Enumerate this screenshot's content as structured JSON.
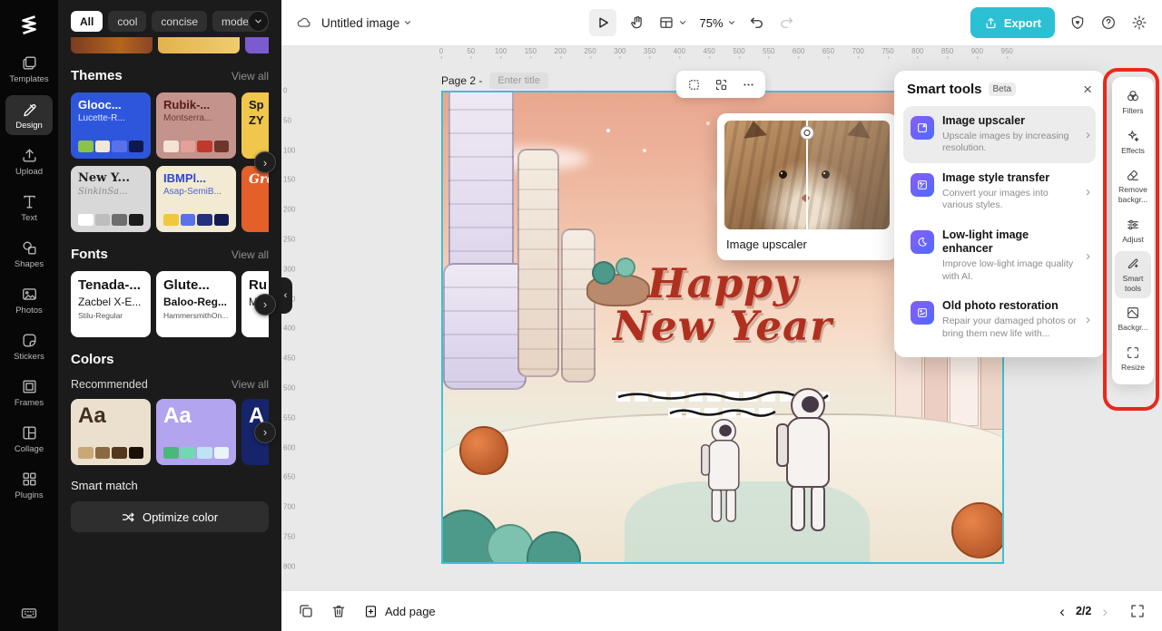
{
  "rail": {
    "items": [
      {
        "label": "Templates"
      },
      {
        "label": "Design"
      },
      {
        "label": "Upload"
      },
      {
        "label": "Text"
      },
      {
        "label": "Shapes"
      },
      {
        "label": "Photos"
      },
      {
        "label": "Stickers"
      },
      {
        "label": "Frames"
      },
      {
        "label": "Collage"
      },
      {
        "label": "Plugins"
      }
    ]
  },
  "panel": {
    "chips": [
      {
        "label": "All"
      },
      {
        "label": "cool"
      },
      {
        "label": "concise"
      },
      {
        "label": "modern"
      }
    ],
    "themes_title": "Themes",
    "view_all": "View all",
    "theme_cards": [
      {
        "title": "Glooc...",
        "subtitle": "Lucette-R...",
        "bg": "#2e56dd",
        "title_color": "#ffffff",
        "sub_color": "#dfe5ff",
        "palette": [
          "#8bc34a",
          "#f1e9d4",
          "#5872e8",
          "#10194d"
        ]
      },
      {
        "title": "Rubik-...",
        "subtitle": "Montserra...",
        "bg": "#c4938c",
        "title_color": "#551d16",
        "sub_color": "#6d3a33",
        "palette": [
          "#f3e3d3",
          "#e5a09a",
          "#c0392b",
          "#6e352a"
        ]
      },
      {
        "title": "Sp",
        "subtitle": "ZY",
        "bg": "#f0c64d",
        "title_color": "#181818",
        "sub_color": "#181818",
        "palette": []
      },
      {
        "title": "New Y...",
        "subtitle": "SinkinSa...",
        "bg": "#d8d8d8",
        "title_color": "#202020",
        "sub_color": "#8a8a8a",
        "palette": [
          "#ffffff",
          "#bdbdbd",
          "#6e6e6e",
          "#1c1c1c"
        ]
      },
      {
        "title": "IBMPl...",
        "subtitle": "Asap-SemiB...",
        "bg": "#f2ead2",
        "title_color": "#2c49c9",
        "sub_color": "#4b62d8",
        "palette": [
          "#efc83d",
          "#5872e8",
          "#24317e",
          "#131c52"
        ]
      },
      {
        "title": "Gro",
        "subtitle": "",
        "bg": "#e4602a",
        "title_color": "#ffffff",
        "sub_color": "#ffffff",
        "palette": []
      }
    ],
    "fonts_title": "Fonts",
    "font_cards": [
      {
        "line1": "Tenada-...",
        "line2": "Zacbel X-E...",
        "line3": "Stilu-Regular"
      },
      {
        "line1": "Glute...",
        "line2": "Baloo-Reg...",
        "line3": "HammersmithOn..."
      },
      {
        "line1": "Ru",
        "line2": "Mor",
        "line3": ""
      }
    ],
    "colors_title": "Colors",
    "recommended_label": "Recommended",
    "color_cards": [
      {
        "sample": "Aa",
        "bg": "#eae0cd",
        "text_color": "#40301b",
        "palette": [
          "#c9a876",
          "#8a6a42",
          "#53381e",
          "#191008"
        ]
      },
      {
        "sample": "Aa",
        "bg": "#b3a4f0",
        "text_color": "#ffffff",
        "palette": [
          "#49b97a",
          "#6fd9b0",
          "#bfe3f2",
          "#e9f4fa"
        ]
      },
      {
        "sample": "A",
        "bg": "#16246b",
        "text_color": "#ffffff",
        "palette": []
      }
    ],
    "smart_match_label": "Smart match",
    "optimize_button": "Optimize color"
  },
  "toolbar": {
    "doc_title": "Untitled image",
    "zoom": "75%",
    "export_label": "Export"
  },
  "workspace": {
    "page_label": "Page 2 -",
    "title_placeholder": "Enter title",
    "headline_line1": "Happy",
    "headline_line2": "New Year",
    "upscaler_caption": "Image upscaler",
    "ruler_h": [
      0,
      50,
      100,
      150,
      200,
      250,
      300,
      350,
      400,
      450,
      500,
      550,
      600,
      650,
      700,
      750,
      800,
      850,
      900,
      950
    ],
    "ruler_v": [
      0,
      50,
      100,
      150,
      200,
      250,
      300,
      350,
      400,
      450,
      500,
      550,
      600,
      650,
      700,
      750,
      800
    ]
  },
  "smart_tools": {
    "title": "Smart tools",
    "badge": "Beta",
    "items": [
      {
        "title": "Image upscaler",
        "desc": "Upscale images by increasing resolution."
      },
      {
        "title": "Image style transfer",
        "desc": "Convert your images into various styles."
      },
      {
        "title": "Low-light image enhancer",
        "desc": "Improve low-light image quality with AI."
      },
      {
        "title": "Old photo restoration",
        "desc": "Repair your damaged photos or bring them new life with..."
      }
    ]
  },
  "right_toolbar": {
    "items": [
      {
        "label": "Filters"
      },
      {
        "label": "Effects"
      },
      {
        "label": "Remove backgr..."
      },
      {
        "label": "Adjust"
      },
      {
        "label": "Smart tools"
      },
      {
        "label": "Backgr..."
      },
      {
        "label": "Resize"
      }
    ]
  },
  "bottom_bar": {
    "add_page": "Add page",
    "page_indicator": "2/2"
  }
}
